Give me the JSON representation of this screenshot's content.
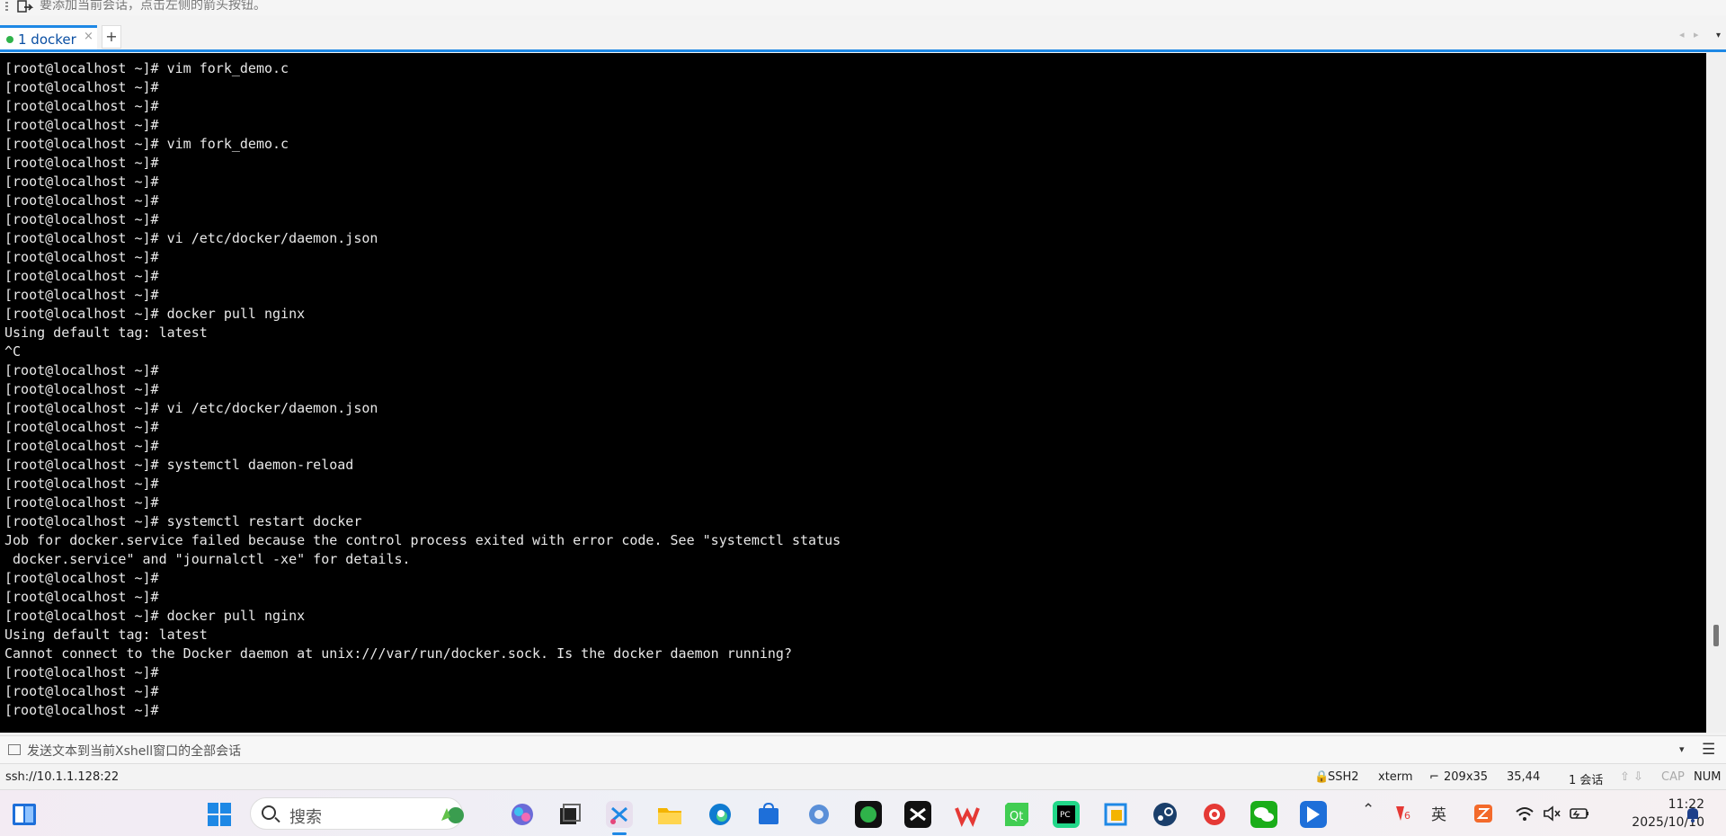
{
  "hint_bar": {
    "text": "要添加当前会话，点击左侧的箭头按钮。"
  },
  "tabs": [
    {
      "label": "1 docker",
      "close": "×"
    }
  ],
  "tab_add": "+",
  "tab_nav": {
    "prev": "◂",
    "next": "▸",
    "menu": "▾"
  },
  "terminal": {
    "lines": [
      "[root@localhost ~]# vim fork_demo.c",
      "[root@localhost ~]#",
      "[root@localhost ~]#",
      "[root@localhost ~]#",
      "[root@localhost ~]# vim fork_demo.c",
      "[root@localhost ~]#",
      "[root@localhost ~]#",
      "[root@localhost ~]#",
      "[root@localhost ~]#",
      "[root@localhost ~]# vi /etc/docker/daemon.json",
      "[root@localhost ~]#",
      "[root@localhost ~]#",
      "[root@localhost ~]#",
      "[root@localhost ~]# docker pull nginx",
      "Using default tag: latest",
      "^C",
      "[root@localhost ~]#",
      "[root@localhost ~]#",
      "[root@localhost ~]# vi /etc/docker/daemon.json",
      "[root@localhost ~]#",
      "[root@localhost ~]#",
      "[root@localhost ~]# systemctl daemon-reload",
      "[root@localhost ~]#",
      "[root@localhost ~]#",
      "[root@localhost ~]# systemctl restart docker",
      "Job for docker.service failed because the control process exited with error code. See \"systemctl status",
      " docker.service\" and \"journalctl -xe\" for details.",
      "[root@localhost ~]#",
      "[root@localhost ~]#",
      "[root@localhost ~]# docker pull nginx",
      "Using default tag: latest",
      "Cannot connect to the Docker daemon at unix:///var/run/docker.sock. Is the docker daemon running?",
      "[root@localhost ~]#",
      "[root@localhost ~]#",
      "[root@localhost ~]#"
    ]
  },
  "send_bar": {
    "text": "发送文本到当前Xshell窗口的全部会话",
    "dropdown": "▾",
    "menu": "☰"
  },
  "status_bar": {
    "connection": "ssh://10.1.1.128:22",
    "protocol": "SSH2",
    "terminal_type": "xterm",
    "size": "209x35",
    "cursor": "35,44",
    "sessions": "1 会话",
    "arrows": "⇧ ⇩",
    "cap": "CAP",
    "num": "NUM"
  },
  "taskbar": {
    "search_placeholder": "搜索",
    "tray_lang": "英",
    "time": "11:22",
    "date": "2025/10/10"
  },
  "colors": {
    "accent": "#1e88e5",
    "terminal_bg": "#000000",
    "terminal_fg": "#e8e8e8",
    "tab_dot": "#2fb34a"
  }
}
